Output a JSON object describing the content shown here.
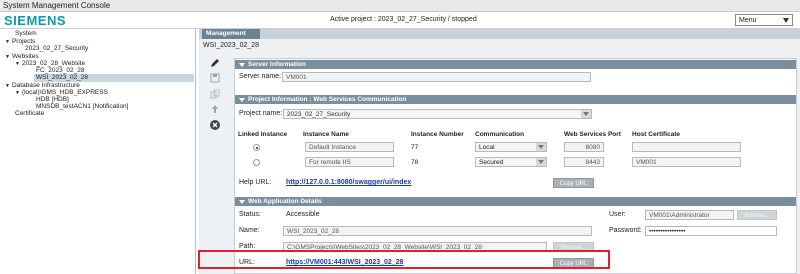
{
  "window": {
    "title": "System Management Console"
  },
  "header": {
    "logo": "SIEMENS",
    "active_project": "Active project : 2023_02_27_Security / stopped",
    "menu_label": "Menu"
  },
  "tree": [
    {
      "label": "System",
      "toggle": ""
    },
    {
      "label": "Projects",
      "toggle": "▼"
    },
    {
      "label": "2023_02_27_Security",
      "toggle": ""
    },
    {
      "label": "Websites",
      "toggle": "▼"
    },
    {
      "label": "2023_02_28_Website",
      "toggle": "▼"
    },
    {
      "label": "FC_2023_02_28",
      "toggle": ""
    },
    {
      "label": "WSI_2023_02_28",
      "toggle": "",
      "selected": true
    },
    {
      "label": "Database Infrastructure",
      "toggle": "▼"
    },
    {
      "label": "(local)\\GMS_HDB_EXPRESS",
      "toggle": "▼"
    },
    {
      "label": "HDB [HDB]",
      "toggle": ""
    },
    {
      "label": "MNSDB_testACN1 [Notification]",
      "toggle": ""
    },
    {
      "label": "Certificate",
      "toggle": ""
    }
  ],
  "tabs": {
    "management": "Management"
  },
  "path": "WSI_2023_02_28",
  "toolbar": [
    "pencil-icon",
    "save-icon",
    "copy-icon",
    "upload-icon",
    "close-icon"
  ],
  "server_info": {
    "header": "Server Information",
    "name_label": "Server name:",
    "name_value": "VM001"
  },
  "project_info": {
    "header": "Project Information : Web Services Communication",
    "project_label": "Project name:",
    "project_value": "2023_02_27_Security",
    "columns": [
      "Linked Instance",
      "Instance Name",
      "Instance Number",
      "Communication",
      "Web Services Port",
      "Host Certificate"
    ],
    "rows": [
      {
        "selected": true,
        "name": "Default Instance",
        "number": "77",
        "communication": "Local",
        "port": "8080",
        "certificate": ""
      },
      {
        "selected": false,
        "name": "For remote IIS",
        "number": "78",
        "communication": "Secured",
        "port": "8443",
        "certificate": "VM001"
      }
    ],
    "help_label": "Help URL:",
    "help_url": "http://127.0.0.1:8080/swagger/ui/index",
    "copy_label": "Copy URL"
  },
  "web_app": {
    "header": "Web Application Details",
    "status_label": "Status:",
    "status_value": "Accessible",
    "name_label": "Name:",
    "name_value": "WSI_2023_02_28",
    "path_label": "Path:",
    "path_value": "C:\\GMSProjects\\WebSites\\2023_02_28_Website\\WSI_2023_02_28",
    "browse_label": "Browse...",
    "user_label": "User:",
    "user_value": "VM001\\Administrator",
    "password_label": "Password:",
    "password_value": "••••••••••••••••",
    "url_label": "URL:",
    "url_value": "https://VM001:443/WSI_2023_02_28",
    "copy_label": "Copy URL"
  }
}
